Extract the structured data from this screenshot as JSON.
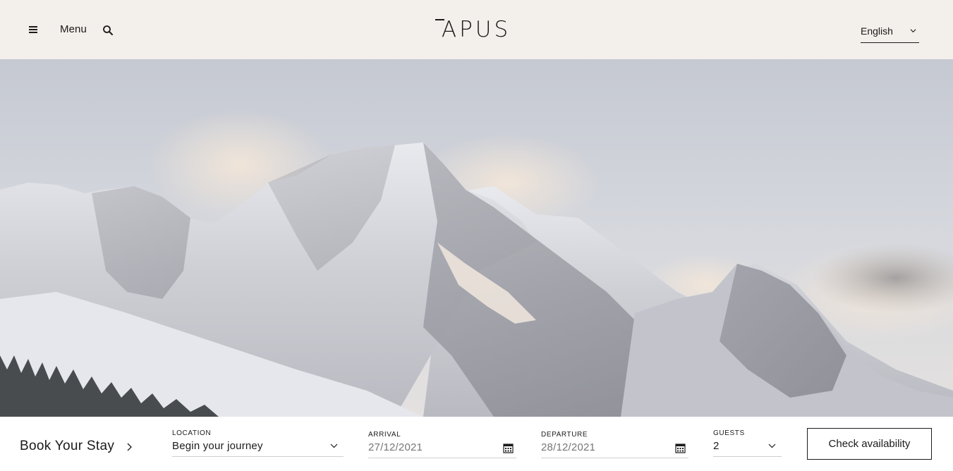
{
  "header": {
    "menu_label": "Menu",
    "logo_text": "APUS",
    "language": "English"
  },
  "icons": {
    "hamburger": "hamburger-icon",
    "search": "search-icon",
    "language_chevron": "chevron-down-icon",
    "book_chevron": "chevron-right-icon",
    "calendar": "calendar-icon"
  },
  "hero": {
    "image": "snow-covered mountain range"
  },
  "booking": {
    "title": "Book Your Stay",
    "location": {
      "label": "LOCATION",
      "value": "Begin your journey"
    },
    "arrival": {
      "label": "ARRIVAL",
      "value": "27/12/2021"
    },
    "departure": {
      "label": "DEPARTURE",
      "value": "28/12/2021"
    },
    "guests": {
      "label": "GUESTS",
      "value": "2"
    },
    "check_button": "Check availability"
  },
  "colors": {
    "header_bg": "#f3efea",
    "text": "#1b1b1b",
    "booking_bg": "#ffffff"
  }
}
